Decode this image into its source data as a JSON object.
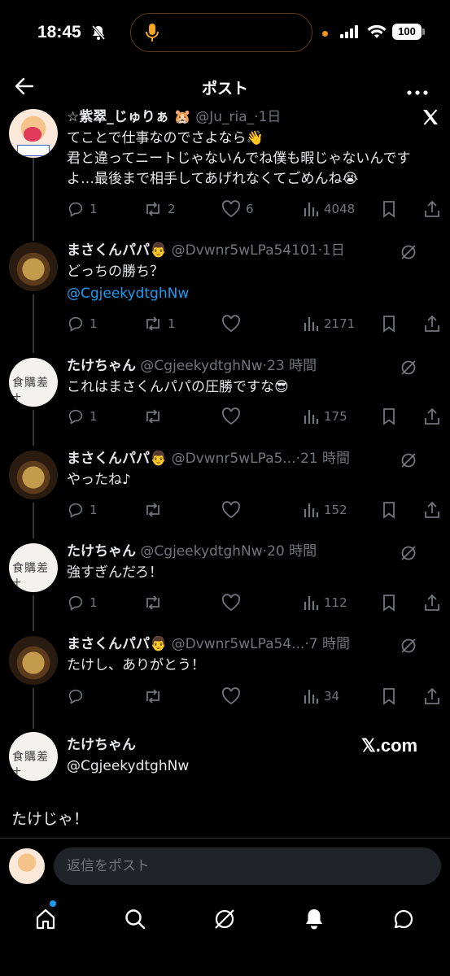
{
  "status": {
    "time": "18:45",
    "battery": "100"
  },
  "header": {
    "title": "ポスト"
  },
  "posts": [
    {
      "name": "☆紫翠_じゅりぁ 🐹",
      "handle": "@Ju_ria_",
      "time": "1日",
      "text": "てことで仕事なのでさよなら👋\n君と違ってニートじゃないんでね僕も暇じゃないんですよ…最後まで相手してあげれなくてごめんね😭",
      "replies": "1",
      "reposts": "2",
      "likes": "6",
      "views": "4048"
    },
    {
      "name": "まさくんパパ👨",
      "handle": "@Dvwnr5wLPa54101",
      "time": "1日",
      "text": "どっちの勝ち？",
      "mention": "@CgjeekydtghNw",
      "replies": "1",
      "reposts": "1",
      "likes": "",
      "views": "2171"
    },
    {
      "name": "たけちゃん",
      "handle": "@CgjeekydtghNw",
      "time": "23 時間",
      "text": "これはまさくんパパの圧勝ですな😎",
      "replies": "1",
      "reposts": "",
      "likes": "",
      "views": "175"
    },
    {
      "name": "まさくんパパ👨",
      "handle": "@Dvwnr5wLPa5...",
      "time": "21 時間",
      "text": "やったね♪",
      "replies": "1",
      "reposts": "",
      "likes": "",
      "views": "152"
    },
    {
      "name": "たけちゃん",
      "handle": "@CgjeekydtghNw",
      "time": "20 時間",
      "text": "強すぎんだろ！",
      "replies": "1",
      "reposts": "",
      "likes": "",
      "views": "112"
    },
    {
      "name": "まさくんパパ👨",
      "handle": "@Dvwnr5wLPa54...",
      "time": "7 時間",
      "text": "たけし、ありがとう！",
      "replies": "",
      "reposts": "",
      "likes": "",
      "views": "34"
    }
  ],
  "main_post": {
    "name": "たけちゃん",
    "handle": "@CgjeekydtghNw",
    "text": "たけじゃ！",
    "watermark": "𝕏.com"
  },
  "avatar_text": {
    "take": "食購差 +"
  },
  "reply_bar": {
    "placeholder": "返信をポスト"
  },
  "colors": {
    "accent": "#1d9bf0",
    "muted": "#71767b",
    "background": "#000000"
  }
}
